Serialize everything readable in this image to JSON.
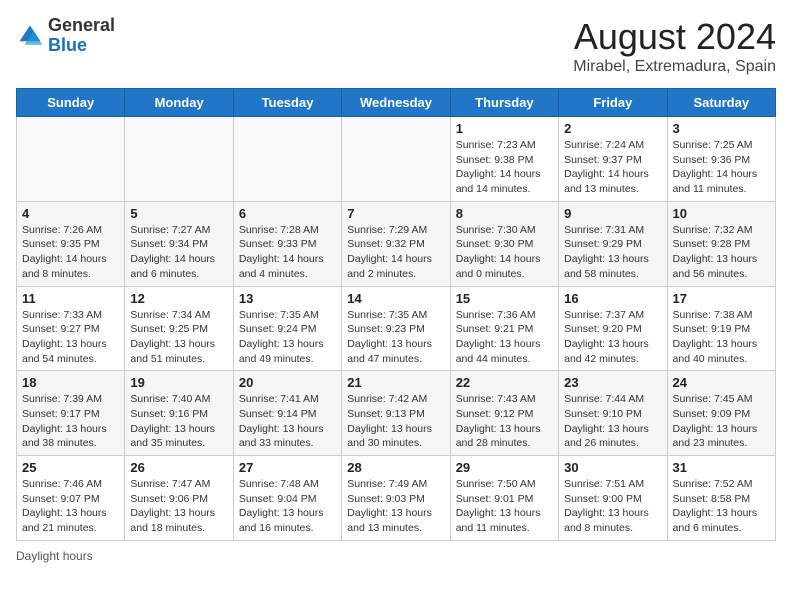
{
  "header": {
    "logo_general": "General",
    "logo_blue": "Blue",
    "month_year": "August 2024",
    "location": "Mirabel, Extremadura, Spain"
  },
  "days_of_week": [
    "Sunday",
    "Monday",
    "Tuesday",
    "Wednesday",
    "Thursday",
    "Friday",
    "Saturday"
  ],
  "weeks": [
    [
      {
        "day": "",
        "info": ""
      },
      {
        "day": "",
        "info": ""
      },
      {
        "day": "",
        "info": ""
      },
      {
        "day": "",
        "info": ""
      },
      {
        "day": "1",
        "info": "Sunrise: 7:23 AM\nSunset: 9:38 PM\nDaylight: 14 hours and 14 minutes."
      },
      {
        "day": "2",
        "info": "Sunrise: 7:24 AM\nSunset: 9:37 PM\nDaylight: 14 hours and 13 minutes."
      },
      {
        "day": "3",
        "info": "Sunrise: 7:25 AM\nSunset: 9:36 PM\nDaylight: 14 hours and 11 minutes."
      }
    ],
    [
      {
        "day": "4",
        "info": "Sunrise: 7:26 AM\nSunset: 9:35 PM\nDaylight: 14 hours and 8 minutes."
      },
      {
        "day": "5",
        "info": "Sunrise: 7:27 AM\nSunset: 9:34 PM\nDaylight: 14 hours and 6 minutes."
      },
      {
        "day": "6",
        "info": "Sunrise: 7:28 AM\nSunset: 9:33 PM\nDaylight: 14 hours and 4 minutes."
      },
      {
        "day": "7",
        "info": "Sunrise: 7:29 AM\nSunset: 9:32 PM\nDaylight: 14 hours and 2 minutes."
      },
      {
        "day": "8",
        "info": "Sunrise: 7:30 AM\nSunset: 9:30 PM\nDaylight: 14 hours and 0 minutes."
      },
      {
        "day": "9",
        "info": "Sunrise: 7:31 AM\nSunset: 9:29 PM\nDaylight: 13 hours and 58 minutes."
      },
      {
        "day": "10",
        "info": "Sunrise: 7:32 AM\nSunset: 9:28 PM\nDaylight: 13 hours and 56 minutes."
      }
    ],
    [
      {
        "day": "11",
        "info": "Sunrise: 7:33 AM\nSunset: 9:27 PM\nDaylight: 13 hours and 54 minutes."
      },
      {
        "day": "12",
        "info": "Sunrise: 7:34 AM\nSunset: 9:25 PM\nDaylight: 13 hours and 51 minutes."
      },
      {
        "day": "13",
        "info": "Sunrise: 7:35 AM\nSunset: 9:24 PM\nDaylight: 13 hours and 49 minutes."
      },
      {
        "day": "14",
        "info": "Sunrise: 7:35 AM\nSunset: 9:23 PM\nDaylight: 13 hours and 47 minutes."
      },
      {
        "day": "15",
        "info": "Sunrise: 7:36 AM\nSunset: 9:21 PM\nDaylight: 13 hours and 44 minutes."
      },
      {
        "day": "16",
        "info": "Sunrise: 7:37 AM\nSunset: 9:20 PM\nDaylight: 13 hours and 42 minutes."
      },
      {
        "day": "17",
        "info": "Sunrise: 7:38 AM\nSunset: 9:19 PM\nDaylight: 13 hours and 40 minutes."
      }
    ],
    [
      {
        "day": "18",
        "info": "Sunrise: 7:39 AM\nSunset: 9:17 PM\nDaylight: 13 hours and 38 minutes."
      },
      {
        "day": "19",
        "info": "Sunrise: 7:40 AM\nSunset: 9:16 PM\nDaylight: 13 hours and 35 minutes."
      },
      {
        "day": "20",
        "info": "Sunrise: 7:41 AM\nSunset: 9:14 PM\nDaylight: 13 hours and 33 minutes."
      },
      {
        "day": "21",
        "info": "Sunrise: 7:42 AM\nSunset: 9:13 PM\nDaylight: 13 hours and 30 minutes."
      },
      {
        "day": "22",
        "info": "Sunrise: 7:43 AM\nSunset: 9:12 PM\nDaylight: 13 hours and 28 minutes."
      },
      {
        "day": "23",
        "info": "Sunrise: 7:44 AM\nSunset: 9:10 PM\nDaylight: 13 hours and 26 minutes."
      },
      {
        "day": "24",
        "info": "Sunrise: 7:45 AM\nSunset: 9:09 PM\nDaylight: 13 hours and 23 minutes."
      }
    ],
    [
      {
        "day": "25",
        "info": "Sunrise: 7:46 AM\nSunset: 9:07 PM\nDaylight: 13 hours and 21 minutes."
      },
      {
        "day": "26",
        "info": "Sunrise: 7:47 AM\nSunset: 9:06 PM\nDaylight: 13 hours and 18 minutes."
      },
      {
        "day": "27",
        "info": "Sunrise: 7:48 AM\nSunset: 9:04 PM\nDaylight: 13 hours and 16 minutes."
      },
      {
        "day": "28",
        "info": "Sunrise: 7:49 AM\nSunset: 9:03 PM\nDaylight: 13 hours and 13 minutes."
      },
      {
        "day": "29",
        "info": "Sunrise: 7:50 AM\nSunset: 9:01 PM\nDaylight: 13 hours and 11 minutes."
      },
      {
        "day": "30",
        "info": "Sunrise: 7:51 AM\nSunset: 9:00 PM\nDaylight: 13 hours and 8 minutes."
      },
      {
        "day": "31",
        "info": "Sunrise: 7:52 AM\nSunset: 8:58 PM\nDaylight: 13 hours and 6 minutes."
      }
    ]
  ],
  "footer": {
    "daylight_label": "Daylight hours"
  }
}
